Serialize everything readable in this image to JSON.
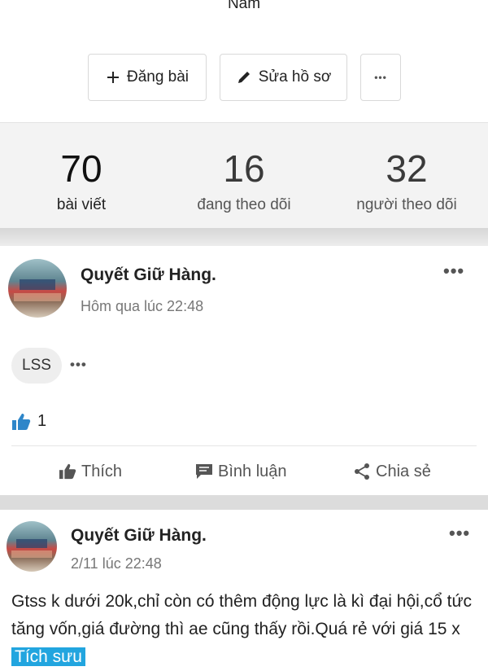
{
  "profile": {
    "name": "Nam"
  },
  "actions": {
    "post_label": "Đăng bài",
    "edit_label": "Sửa hồ sơ",
    "more_label": "•••"
  },
  "stats": [
    {
      "value": "70",
      "label": "bài viết"
    },
    {
      "value": "16",
      "label": "đang theo dõi"
    },
    {
      "value": "32",
      "label": "người theo dõi"
    }
  ],
  "posts": [
    {
      "author": "Quyết Giữ Hàng.",
      "time": "Hôm qua lúc 22:48",
      "tag": "LSS",
      "tag_more": "•••",
      "likes": "1",
      "like_label": "Thích",
      "comment_label": "Bình luận",
      "share_label": "Chia sẻ",
      "more": "•••"
    },
    {
      "author": "Quyết Giữ Hàng.",
      "time": "2/11 lúc 22:48",
      "more": "•••",
      "text": "Gtss k dưới 20k,chỉ còn có thêm động lực là kì đại hội,cổ tức tăng vốn,giá đường thì ae cũng thấy rồi.Quá rẻ với giá 15 x ",
      "highlight": "Tích sưu"
    }
  ],
  "colors": {
    "accent": "#22a5df",
    "stats_bg": "#f3f3f3",
    "divider": "#dcdcdc"
  }
}
